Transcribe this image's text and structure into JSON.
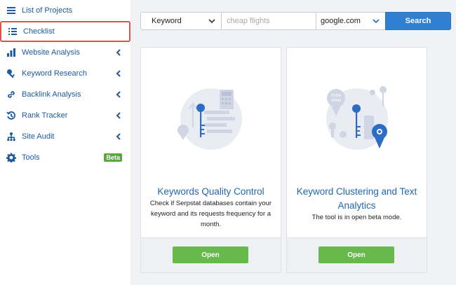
{
  "sidebar": {
    "items": [
      {
        "label": "List of Projects",
        "icon": "menu-icon"
      },
      {
        "label": "Checklist",
        "icon": "checklist-icon"
      },
      {
        "label": "Website Analysis",
        "icon": "chart-icon"
      },
      {
        "label": "Keyword Research",
        "icon": "key-icon"
      },
      {
        "label": "Backlink Analysis",
        "icon": "link-icon"
      },
      {
        "label": "Rank Tracker",
        "icon": "history-icon"
      },
      {
        "label": "Site Audit",
        "icon": "sitemap-icon"
      },
      {
        "label": "Tools",
        "icon": "gear-icon",
        "badge": "Beta"
      }
    ]
  },
  "search": {
    "mode": "Keyword",
    "placeholder": "cheap flights",
    "database": "google.com",
    "button": "Search"
  },
  "cards": [
    {
      "title": "Keywords Quality Control",
      "description": "Check if Serpstat databases contain your keyword and its requests frequency for a month.",
      "button": "Open"
    },
    {
      "title": "Keyword Clustering and Text Analytics",
      "description": "The tool is in open beta mode.",
      "button": "Open",
      "illustration_text": "OVER SPAM"
    }
  ],
  "colors": {
    "link_blue": "#1f66b0",
    "search_button": "#2f7fd3",
    "open_button": "#66b94a",
    "active_outline": "#d9534f",
    "beta_badge": "#5aa83d"
  }
}
